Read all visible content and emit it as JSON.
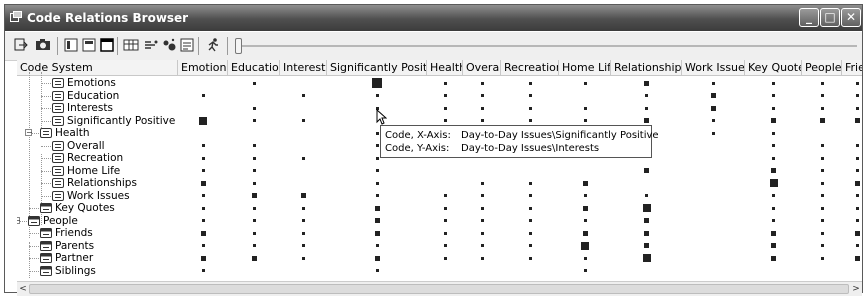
{
  "window": {
    "title": "Code Relations Browser"
  },
  "window_buttons": [
    {
      "name": "minimize-button",
      "glyph": "_"
    },
    {
      "name": "maximize-button",
      "glyph": "□"
    },
    {
      "name": "close-button",
      "glyph": "✕"
    }
  ],
  "toolbar": {
    "icons": [
      "export-icon",
      "camera-icon",
      "single-column-icon",
      "split-view-icon",
      "full-view-icon",
      "table-icon",
      "codes-icon",
      "bubble-icon",
      "settings-icon",
      "run-icon"
    ],
    "slider_level": 0
  },
  "columns": [
    "Code System",
    "Emotions",
    "Education",
    "Interests",
    "Significantly Positive",
    "Health",
    "Overall",
    "Recreation",
    "Home Life",
    "Relationships",
    "Work Issues",
    "Key Quotes",
    "People",
    "Frien"
  ],
  "rows": [
    {
      "label": "Emotions",
      "level": 2,
      "toggle": "",
      "icon": "code-icon",
      "cells": [
        0,
        1,
        0,
        4,
        1,
        1,
        1,
        1,
        2,
        1,
        1,
        1,
        1
      ]
    },
    {
      "label": "Education",
      "level": 2,
      "toggle": "",
      "icon": "code-icon",
      "cells": [
        1,
        0,
        1,
        1,
        1,
        1,
        1,
        0,
        1,
        2,
        1,
        1,
        1
      ]
    },
    {
      "label": "Interests",
      "level": 2,
      "toggle": "",
      "icon": "code-icon",
      "cells": [
        0,
        1,
        0,
        1,
        1,
        1,
        1,
        1,
        1,
        2,
        1,
        1,
        1
      ]
    },
    {
      "label": "Significantly Positive",
      "level": 2,
      "toggle": "",
      "icon": "code-icon",
      "cells": [
        3,
        1,
        1,
        0,
        1,
        1,
        1,
        1,
        2,
        1,
        2,
        2,
        2
      ]
    },
    {
      "label": "Health",
      "level": 1,
      "toggle": "−",
      "icon": "code-icon",
      "cells": [
        0,
        0,
        0,
        1,
        0,
        0,
        0,
        0,
        0,
        1,
        1,
        0,
        0
      ]
    },
    {
      "label": "Overall",
      "level": 2,
      "toggle": "",
      "icon": "code-icon",
      "cells": [
        1,
        1,
        0,
        1,
        0,
        0,
        0,
        0,
        0,
        0,
        1,
        1,
        1
      ]
    },
    {
      "label": "Recreation",
      "level": 2,
      "toggle": "",
      "icon": "code-icon",
      "cells": [
        1,
        1,
        1,
        1,
        0,
        0,
        0,
        0,
        0,
        0,
        1,
        1,
        1
      ]
    },
    {
      "label": "Home Life",
      "level": 2,
      "toggle": "",
      "icon": "code-icon",
      "cells": [
        1,
        1,
        0,
        1,
        0,
        0,
        0,
        0,
        2,
        0,
        2,
        1,
        1
      ]
    },
    {
      "label": "Relationships",
      "level": 2,
      "toggle": "",
      "icon": "code-icon",
      "cells": [
        2,
        1,
        0,
        1,
        0,
        1,
        1,
        2,
        0,
        0,
        3,
        1,
        2
      ]
    },
    {
      "label": "Work Issues",
      "level": 2,
      "toggle": "",
      "icon": "code-icon",
      "cells": [
        1,
        2,
        2,
        1,
        1,
        1,
        1,
        1,
        1,
        0,
        1,
        1,
        1
      ]
    },
    {
      "label": "Key Quotes",
      "level": 1,
      "toggle": "",
      "icon": "code-set-icon",
      "cells": [
        1,
        1,
        1,
        2,
        1,
        1,
        1,
        2,
        3,
        0,
        1,
        1,
        1
      ]
    },
    {
      "label": "People",
      "level": 0,
      "toggle": "−",
      "icon": "code-set-icon",
      "cells": [
        1,
        1,
        1,
        2,
        1,
        1,
        1,
        1,
        2,
        0,
        1,
        1,
        1
      ]
    },
    {
      "label": "Friends",
      "level": 1,
      "toggle": "",
      "icon": "code-set-icon",
      "cells": [
        2,
        1,
        1,
        2,
        1,
        1,
        1,
        2,
        2,
        0,
        2,
        1,
        2
      ]
    },
    {
      "label": "Parents",
      "level": 1,
      "toggle": "",
      "icon": "code-set-icon",
      "cells": [
        1,
        1,
        1,
        1,
        1,
        1,
        1,
        3,
        2,
        0,
        2,
        1,
        1
      ]
    },
    {
      "label": "Partner",
      "level": 1,
      "toggle": "",
      "icon": "code-set-icon",
      "cells": [
        2,
        2,
        1,
        2,
        1,
        1,
        1,
        1,
        3,
        0,
        2,
        1,
        2
      ]
    },
    {
      "label": "Siblings",
      "level": 1,
      "toggle": "",
      "icon": "code-set-icon",
      "cells": [
        1,
        0,
        0,
        1,
        0,
        0,
        0,
        1,
        0,
        0,
        0,
        0,
        0
      ]
    }
  ],
  "tooltip": {
    "line1": {
      "key": "Code, X-Axis:",
      "value": "Day-to-Day Issues\\Significantly Positive"
    },
    "line2": {
      "key": "Code, Y-Axis:",
      "value": "Day-to-Day Issues\\Interests"
    }
  },
  "scrollbar": {
    "left_arrow": "<",
    "right_arrow": ">"
  }
}
